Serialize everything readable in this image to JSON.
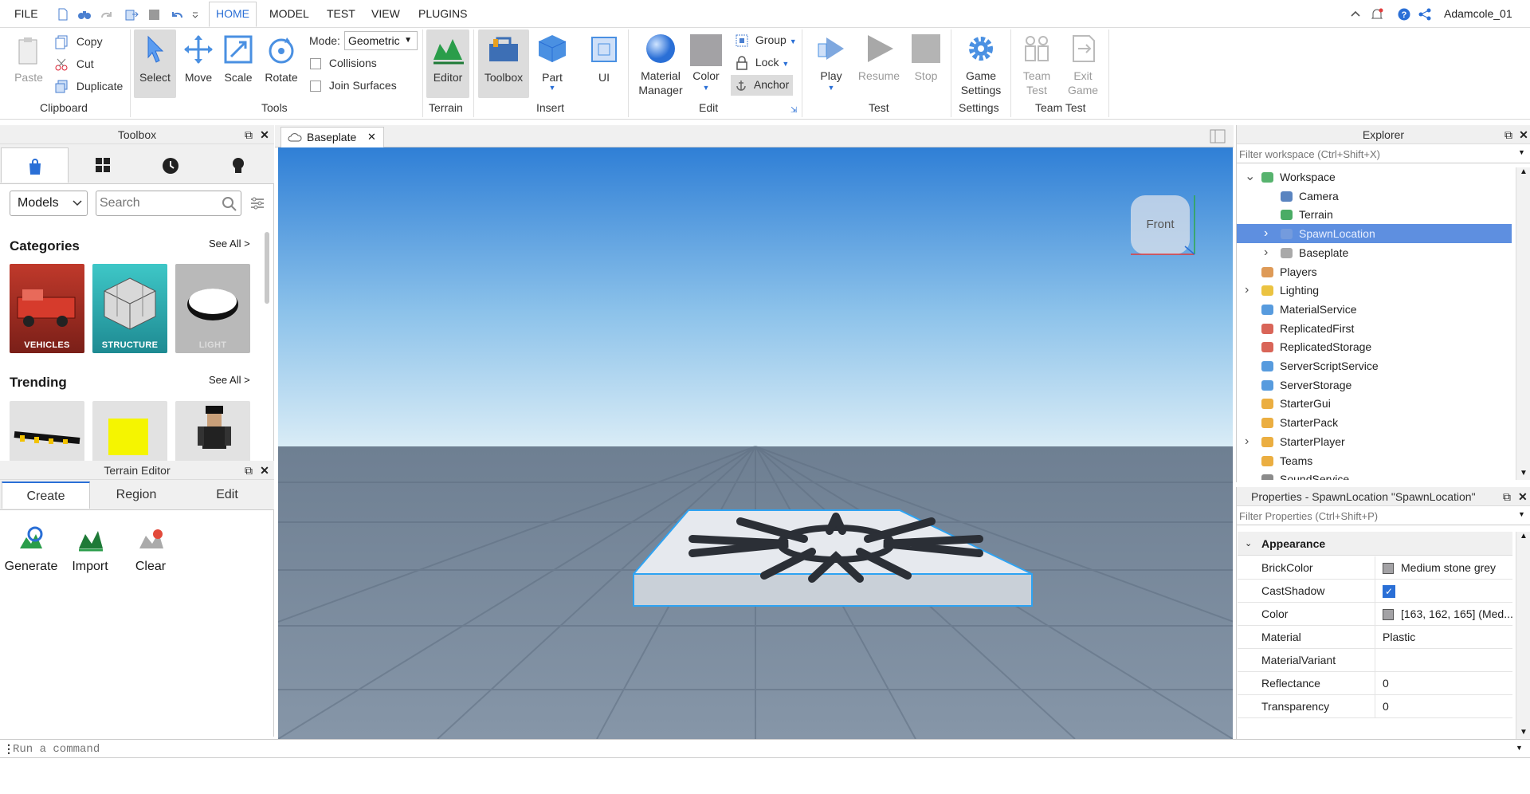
{
  "menubar": {
    "file": "FILE",
    "tabs": [
      "HOME",
      "MODEL",
      "TEST",
      "VIEW",
      "PLUGINS"
    ],
    "username": "Adamcole_01"
  },
  "ribbon": {
    "clipboard": {
      "paste": "Paste",
      "copy": "Copy",
      "cut": "Cut",
      "duplicate": "Duplicate",
      "group_label": "Clipboard"
    },
    "tools": {
      "select": "Select",
      "move": "Move",
      "scale": "Scale",
      "rotate": "Rotate",
      "mode_label": "Mode:",
      "mode_value": "Geometric",
      "collisions": "Collisions",
      "join_surfaces": "Join Surfaces",
      "group_label": "Tools"
    },
    "terrain": {
      "editor": "Editor",
      "group_label": "Terrain"
    },
    "insert": {
      "toolbox": "Toolbox",
      "part": "Part",
      "ui": "UI",
      "group_label": "Insert"
    },
    "edit": {
      "material_manager_1": "Material",
      "material_manager_2": "Manager",
      "color": "Color",
      "group": "Group",
      "lock": "Lock",
      "anchor": "Anchor",
      "group_label": "Edit"
    },
    "test": {
      "play": "Play",
      "resume": "Resume",
      "stop": "Stop",
      "group_label": "Test"
    },
    "settings": {
      "game_settings_1": "Game",
      "game_settings_2": "Settings",
      "group_label": "Settings"
    },
    "team_test": {
      "team_test_1": "Team",
      "team_test_2": "Test",
      "exit_game_1": "Exit",
      "exit_game_2": "Game",
      "group_label": "Team Test"
    }
  },
  "toolbox": {
    "title": "Toolbox",
    "category_select": "Models",
    "search_placeholder": "Search",
    "categories_heading": "Categories",
    "see_all": "See All >",
    "categories": [
      "VEHICLES",
      "STRUCTURE",
      "LIGHT"
    ],
    "trending_heading": "Trending"
  },
  "terrain_editor": {
    "title": "Terrain Editor",
    "tabs": [
      "Create",
      "Region",
      "Edit"
    ],
    "tools": [
      "Generate",
      "Import",
      "Clear"
    ]
  },
  "document": {
    "tab": "Baseplate",
    "view_cube_label": "Front"
  },
  "explorer": {
    "title": "Explorer",
    "filter_placeholder": "Filter workspace (Ctrl+Shift+X)",
    "items": [
      {
        "label": "Workspace",
        "icon": "workspace-icon",
        "expanded": true
      },
      {
        "label": "Camera",
        "icon": "camera-icon"
      },
      {
        "label": "Terrain",
        "icon": "terrain-icon"
      },
      {
        "label": "SpawnLocation",
        "icon": "spawn-icon",
        "selected": true
      },
      {
        "label": "Baseplate",
        "icon": "part-icon"
      },
      {
        "label": "Players",
        "icon": "players-icon"
      },
      {
        "label": "Lighting",
        "icon": "lighting-icon"
      },
      {
        "label": "MaterialService",
        "icon": "material-service-icon"
      },
      {
        "label": "ReplicatedFirst",
        "icon": "replicated-first-icon"
      },
      {
        "label": "ReplicatedStorage",
        "icon": "replicated-storage-icon"
      },
      {
        "label": "ServerScriptService",
        "icon": "server-script-service-icon"
      },
      {
        "label": "ServerStorage",
        "icon": "server-storage-icon"
      },
      {
        "label": "StarterGui",
        "icon": "starter-gui-icon"
      },
      {
        "label": "StarterPack",
        "icon": "starter-pack-icon"
      },
      {
        "label": "StarterPlayer",
        "icon": "starter-player-icon"
      },
      {
        "label": "Teams",
        "icon": "teams-icon"
      },
      {
        "label": "SoundService",
        "icon": "sound-service-icon"
      }
    ]
  },
  "properties": {
    "title": "Properties - SpawnLocation \"SpawnLocation\"",
    "filter_placeholder": "Filter Properties (Ctrl+Shift+P)",
    "section": "Appearance",
    "rows": [
      {
        "name": "BrickColor",
        "value": "Medium stone grey",
        "swatch": "#a3a2a5"
      },
      {
        "name": "CastShadow",
        "value": "",
        "checkbox": true
      },
      {
        "name": "Color",
        "value": "[163, 162, 165] (Med...",
        "swatch": "#a3a2a5"
      },
      {
        "name": "Material",
        "value": "Plastic"
      },
      {
        "name": "MaterialVariant",
        "value": ""
      },
      {
        "name": "Reflectance",
        "value": "0"
      },
      {
        "name": "Transparency",
        "value": "0"
      }
    ]
  },
  "command_bar": {
    "placeholder": "Run a command"
  },
  "colors": {
    "accent": "#2a6fd6",
    "selection": "#5e8fe0"
  }
}
